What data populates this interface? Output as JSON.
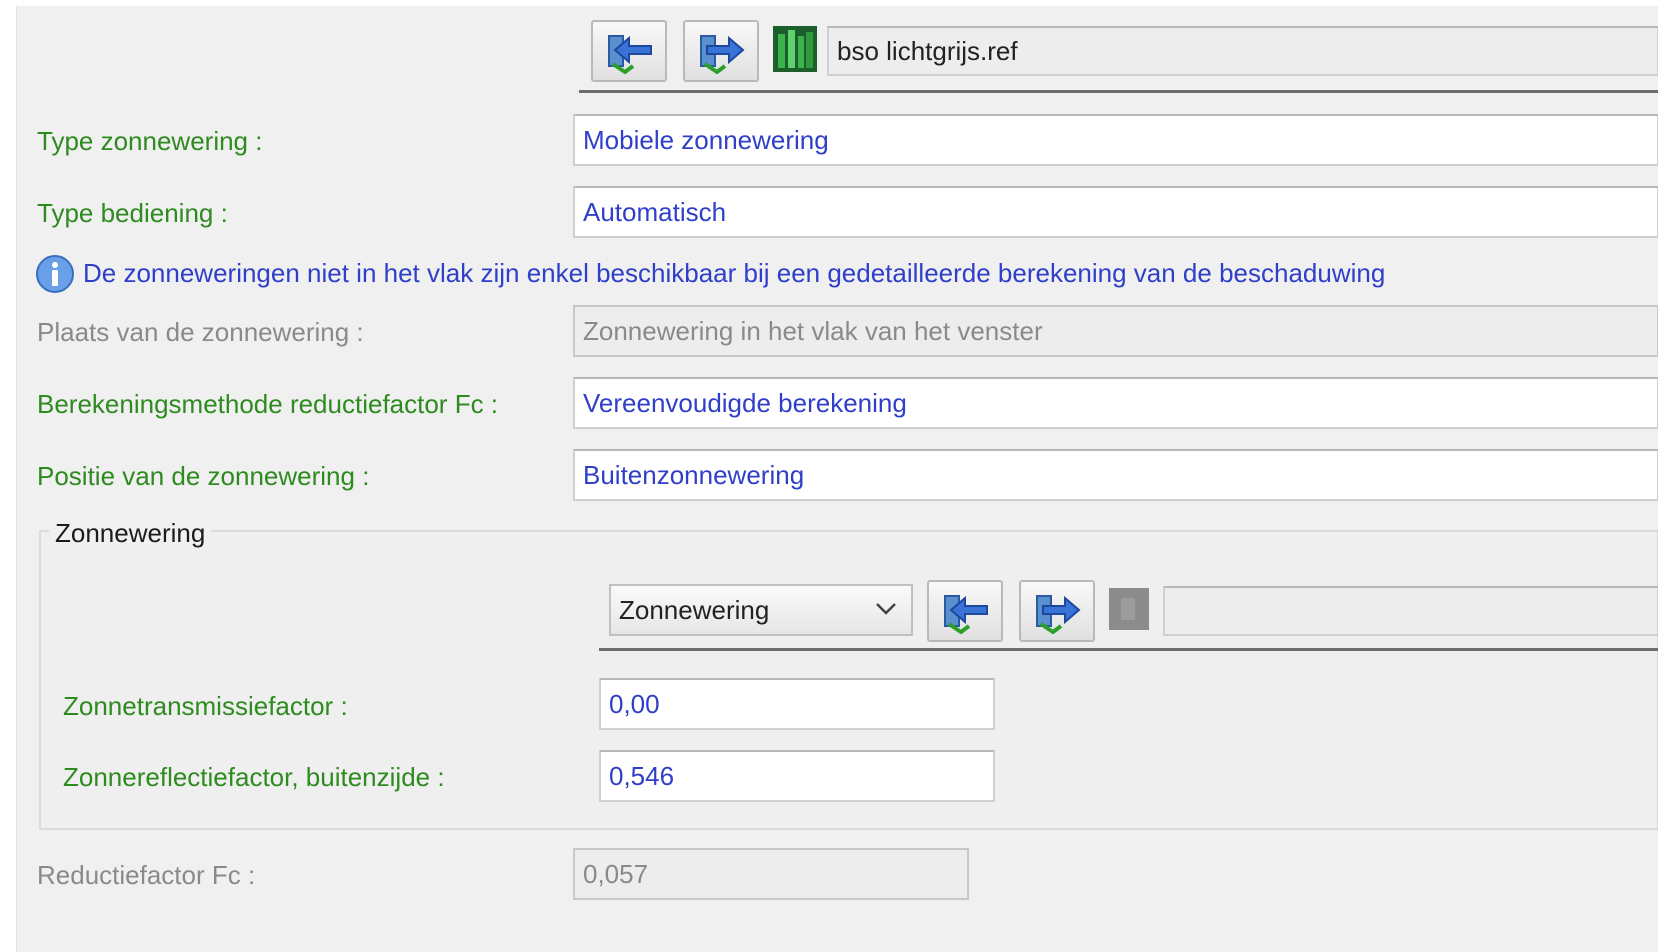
{
  "header": {
    "ref_file": "bso lichtgrijs.ref",
    "import_icon": "import-arrow-left-icon",
    "export_icon": "export-arrow-right-icon",
    "library_icon": "library-books-icon"
  },
  "fields": {
    "type_zonnewering": {
      "label": "Type zonnewering :",
      "value": "Mobiele zonnewering"
    },
    "type_bediening": {
      "label": "Type bediening :",
      "value": "Automatisch"
    },
    "info_message": "De zonneweringen niet in het vlak zijn enkel beschikbaar bij een gedetailleerde berekening van de beschaduwing",
    "plaats": {
      "label": "Plaats van de zonnewering :",
      "value": "Zonnewering in het vlak van het venster"
    },
    "berekeningsmethode": {
      "label": "Berekeningsmethode reductiefactor Fc :",
      "value": "Vereenvoudigde berekening"
    },
    "positie": {
      "label": "Positie van de zonnewering :",
      "value": "Buitenzonnewering"
    }
  },
  "group": {
    "title": "Zonnewering",
    "combo_value": "Zonnewering",
    "ref_file": "",
    "transmissie": {
      "label": "Zonnetransmissiefactor :",
      "value": "0,00"
    },
    "reflectie": {
      "label": "Zonnereflectiefactor, buitenzijde :",
      "value": "0,546"
    }
  },
  "reductie": {
    "label": "Reductiefactor Fc :",
    "value": "0,057"
  },
  "colors": {
    "label_green": "#2e8b1f",
    "value_blue": "#2f3fc8",
    "disabled_grey": "#8a8a8a",
    "panel_bg": "#f0f0f0"
  }
}
